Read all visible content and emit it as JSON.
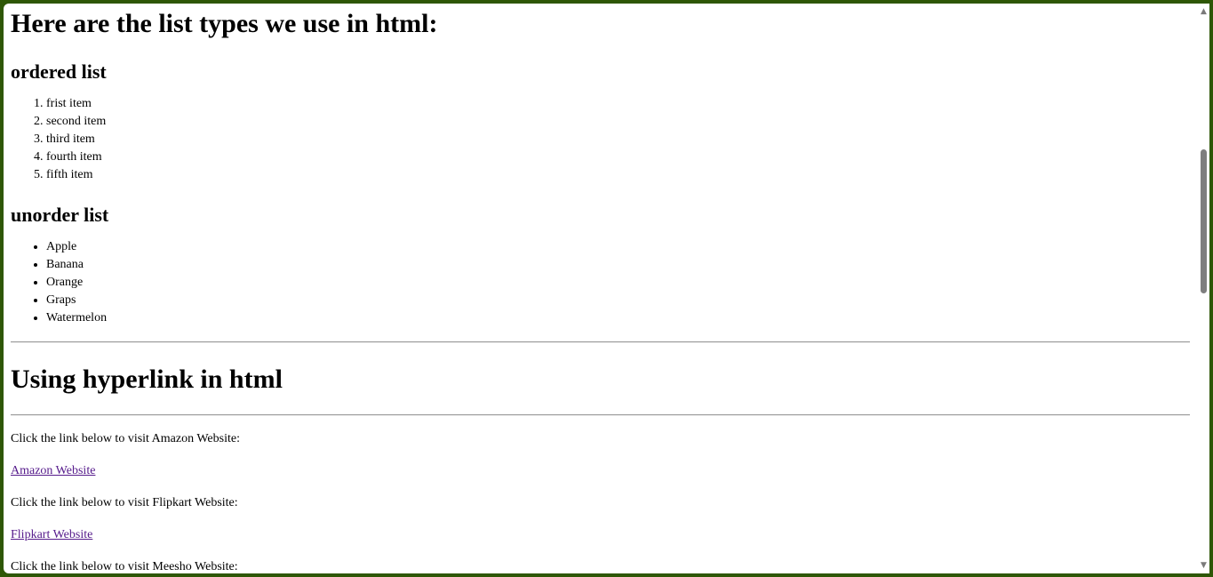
{
  "page": {
    "heading_lists": "Here are the list types we use in html:",
    "ordered_heading": "ordered list",
    "ordered_items": [
      "frist item",
      "second item",
      "third item",
      "fourth item",
      "fifth item"
    ],
    "unordered_heading": "unorder list",
    "unordered_items": [
      "Apple",
      "Banana",
      "Orange",
      "Graps",
      "Watermelon"
    ],
    "heading_links": "Using hyperlink in html",
    "amazon_text": "Click the link below to visit Amazon Website:",
    "amazon_link": "Amazon Website",
    "flipkart_text": "Click the link below to visit Flipkart Website:",
    "flipkart_link": "Flipkart Website",
    "meesho_text": "Click the link below to visit Meesho Website:"
  },
  "colors": {
    "frame_border": "#2e5706",
    "link_visited": "#551a8b",
    "scroll_thumb": "#7e7e7e"
  },
  "icons": {
    "scroll_up": "triangle-up-icon",
    "scroll_down": "triangle-down-icon"
  }
}
